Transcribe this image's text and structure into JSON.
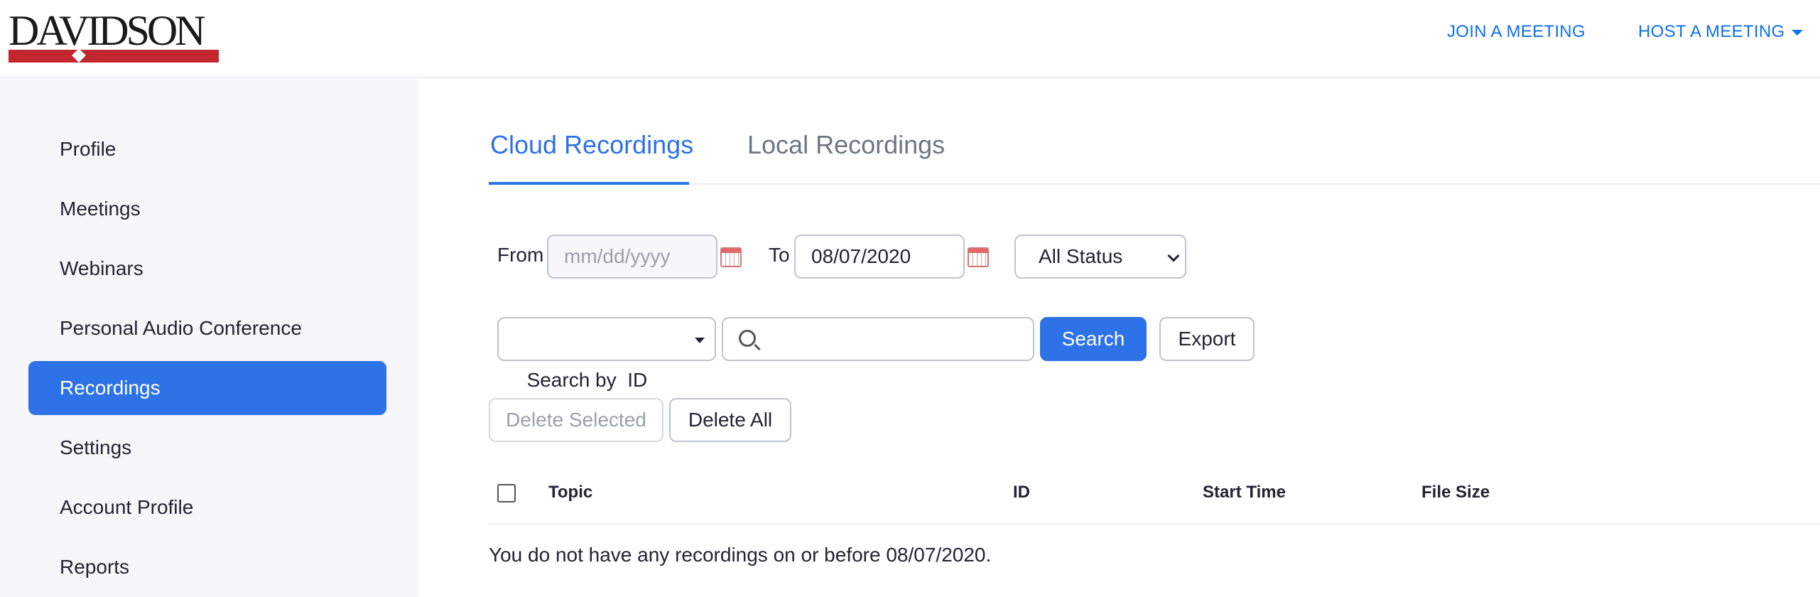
{
  "header": {
    "logo_text": "DAVIDSON",
    "join_label": "JOIN A MEETING",
    "host_label": "HOST A MEETING"
  },
  "sidebar": {
    "items": [
      {
        "label": "Profile"
      },
      {
        "label": "Meetings"
      },
      {
        "label": "Webinars"
      },
      {
        "label": "Personal Audio Conference"
      },
      {
        "label": "Recordings"
      },
      {
        "label": "Settings"
      },
      {
        "label": "Account Profile"
      },
      {
        "label": "Reports"
      }
    ],
    "active": "Recordings"
  },
  "tabs": {
    "cloud": "Cloud Recordings",
    "local": "Local Recordings",
    "active": "Cloud Recordings"
  },
  "filters": {
    "from_label": "From",
    "from_placeholder": "mm/dd/yyyy",
    "to_label": "To",
    "to_value": "08/07/2020",
    "status_value": "All Status",
    "search_by_value": "Search by  ID",
    "search_placeholder": "",
    "search_button": "Search",
    "export_button": "Export"
  },
  "actions": {
    "delete_selected": "Delete Selected",
    "delete_all": "Delete All"
  },
  "table": {
    "columns": [
      "Topic",
      "ID",
      "Start Time",
      "File Size"
    ],
    "empty_message": "You do not have any recordings on or before 08/07/2020."
  },
  "colors": {
    "accent": "#2d72e6",
    "link": "#0e71eb",
    "logo_red": "#c1272d"
  }
}
